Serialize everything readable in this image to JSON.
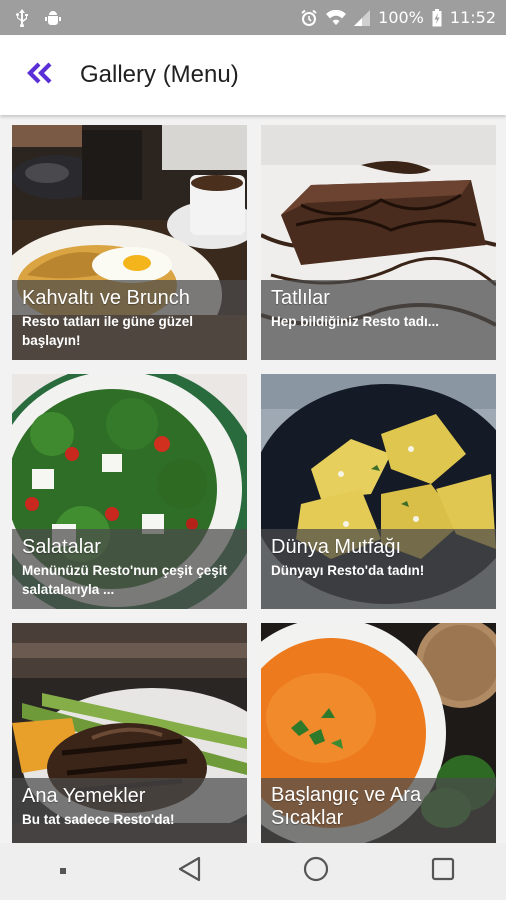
{
  "status_bar": {
    "battery": "100%",
    "time": "11:52",
    "icons": [
      "usb-icon",
      "android-debug-icon",
      "alarm-icon",
      "wifi-icon",
      "signal-icon",
      "battery-icon"
    ]
  },
  "app_bar": {
    "title": "Gallery (Menu)",
    "back_icon": "double-chevron-left-icon",
    "accent_color": "#5a2fd6"
  },
  "gallery": {
    "items": [
      {
        "title": "Kahvaltı ve Brunch",
        "subtitle": "Resto tatları ile güne güzel başlayın!"
      },
      {
        "title": "Tatlılar",
        "subtitle": "Hep bildiğiniz Resto tadı..."
      },
      {
        "title": "Salatalar",
        "subtitle": "Menünüzü Resto'nun çeşit çeşit salatalarıyla ..."
      },
      {
        "title": "Dünya Mutfağı",
        "subtitle": "Dünyayı Resto'da tadın!"
      },
      {
        "title": "Ana Yemekler",
        "subtitle": "Bu tat sadece Resto'da!"
      },
      {
        "title": "Başlangıç ve Ara Sıcaklar",
        "subtitle": ""
      }
    ]
  },
  "nav_bar": {
    "icons": [
      "menu-dot-icon",
      "back-triangle-icon",
      "home-circle-icon",
      "recents-square-icon"
    ]
  }
}
